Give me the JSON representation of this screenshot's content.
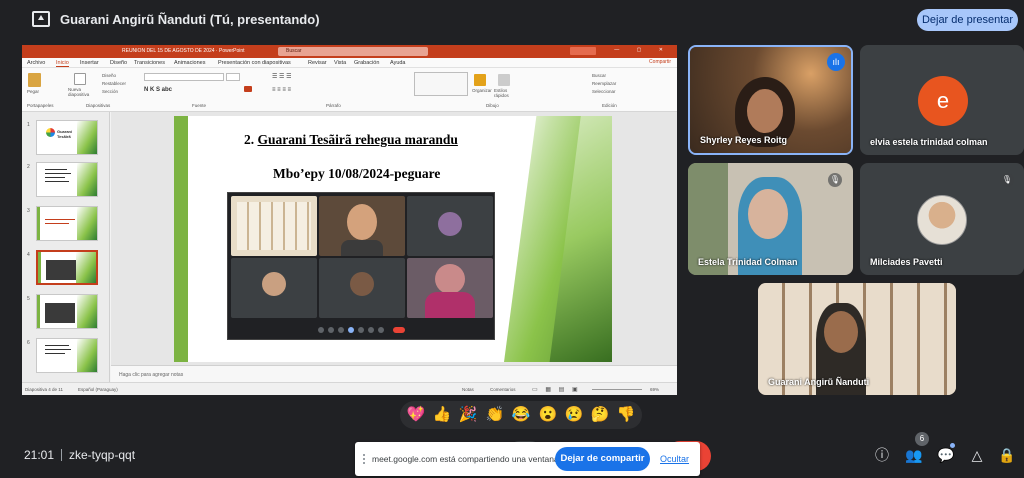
{
  "topbar": {
    "title": "Guarani Angirũ Ñanduti (Tú, presentando)",
    "stop_presenting": "Dejar de presentar"
  },
  "powerpoint": {
    "window_title": "REUNION DEL 15 DE AGOSTO DE 2024 · PowerPoint",
    "search_placeholder": "Buscar",
    "menu": [
      "Archivo",
      "Inicio",
      "Insertar",
      "Diseño",
      "Transiciones",
      "Animaciones",
      "Presentación con diapositivas",
      "Revisar",
      "Vista",
      "Grabación",
      "Ayuda"
    ],
    "share_label": "Compartir",
    "ribbon_groups": [
      "Portapapeles",
      "Diapositivas",
      "Fuente",
      "Párrafo",
      "Dibujo",
      "Edición"
    ],
    "ribbon_labels": {
      "paste": "Pegar",
      "new_slide": "Nueva diapositiva",
      "design": "Diseño",
      "reset": "Restablecer",
      "section": "Sección",
      "organize": "Organizar",
      "quick_styles": "Estilos rápidos",
      "find": "Buscar",
      "replace": "Reemplazar",
      "select": "Seleccionar"
    },
    "slide_numbers": [
      "1",
      "2",
      "3",
      "4",
      "5",
      "6"
    ],
    "thumb1_caption": "Guarani Tesãirã",
    "slide": {
      "title_num": "2.",
      "title_text": "Guarani Tesãirã rehegua marandu",
      "subtitle": "Mbo’epy 10/08/2024-peguare"
    },
    "notes_placeholder": "Haga clic para agregar notas",
    "status": {
      "slide_count": "Diapositiva 4 de 11",
      "language": "Español (Paraguay)",
      "notes": "Notas",
      "comments": "Comentarios",
      "zoom": "69%"
    }
  },
  "participants": [
    {
      "name": "Shyrley Reyes Roitg"
    },
    {
      "name": "elvia estela trinidad colman",
      "initial": "e"
    },
    {
      "name": "Estela Trinidad Colman"
    },
    {
      "name": "Milciades Pavetti"
    },
    {
      "name": "Guarani Angirũ Ñanduti"
    }
  ],
  "reactions": [
    "💖",
    "👍",
    "🎉",
    "👏",
    "😂",
    "😮",
    "😢",
    "🤔",
    "👎"
  ],
  "bottom": {
    "time": "21:01",
    "meeting_code": "zke-tyqp-qqt",
    "share_message": "meet.google.com está compartiendo una ventana.",
    "stop_sharing": "Dejar de compartir",
    "hide": "Ocultar",
    "participant_count": "6"
  },
  "colors": {
    "background": "#202124",
    "ppt_accent": "#c43e1c",
    "meet_blue": "#1a73e8",
    "stop_presenting_bg": "#a8c7fa",
    "avatar_orange": "#e8551f",
    "slide_green": "#7cb342"
  }
}
